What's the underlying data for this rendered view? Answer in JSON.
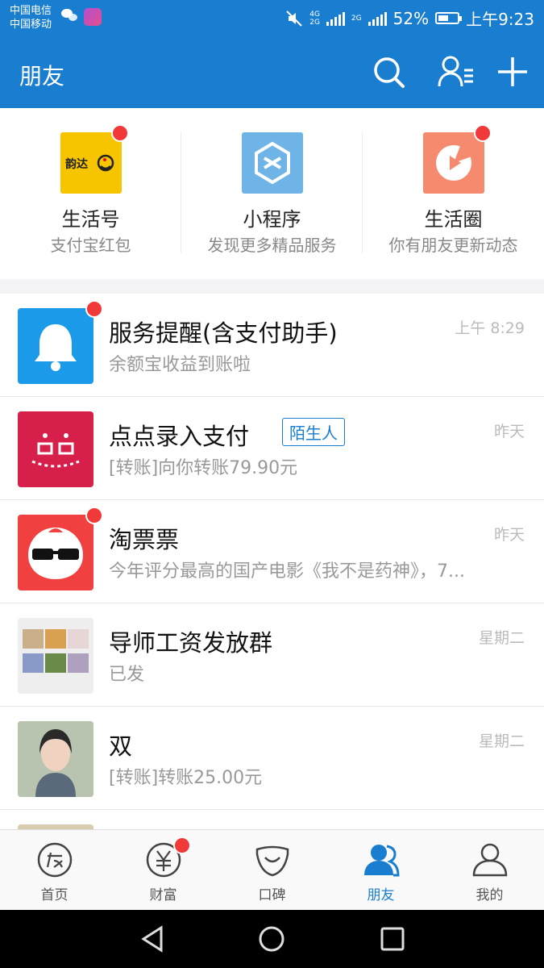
{
  "status_bar": {
    "carrier_1": "中国电信",
    "carrier_2": "中国移动",
    "net_1": "4G",
    "net_2": "2G",
    "net_3": "2G",
    "battery_text": "52%",
    "battery_level_percent": 52,
    "time": "上午9:23"
  },
  "header": {
    "title": "朋友",
    "icons": [
      "search-icon",
      "contacts-icon",
      "add-icon"
    ]
  },
  "quick_apps": [
    {
      "title": "生活号",
      "subtitle": "支付宝红包",
      "icon": "yunda-icon",
      "logo_text": "韵达",
      "badge": true
    },
    {
      "title": "小程序",
      "subtitle": "发现更多精品服务",
      "icon": "mini-program-icon",
      "badge": false
    },
    {
      "title": "生活圈",
      "subtitle": "你有朋友更新动态",
      "icon": "life-circle-icon",
      "badge": true
    }
  ],
  "messages": [
    {
      "title": "服务提醒(含支付助手)",
      "subtitle": "余额宝收益到账啦",
      "time": "上午 8:29",
      "badge": true,
      "tag": "",
      "avatar": "bell-icon"
    },
    {
      "title": "点点录入支付",
      "subtitle": "[转账]向你转账79.90元",
      "time": "昨天",
      "badge": false,
      "tag": "陌生人",
      "avatar": "diandian-icon"
    },
    {
      "title": "淘票票",
      "subtitle": "今年评分最高的国产电影《我不是药神》，7...",
      "time": "昨天",
      "badge": true,
      "tag": "",
      "avatar": "taopiaopiao-icon"
    },
    {
      "title": "导师工资发放群",
      "subtitle": "已发",
      "time": "星期二",
      "badge": false,
      "tag": "",
      "avatar": "group-avatar"
    },
    {
      "title": "双",
      "subtitle": "[转账]转账25.00元",
      "time": "星期二",
      "badge": false,
      "tag": "",
      "avatar": "user-avatar"
    }
  ],
  "tabbar": [
    {
      "label": "首页",
      "icon": "home-icon",
      "active": false,
      "badge": false
    },
    {
      "label": "财富",
      "icon": "wealth-icon",
      "active": false,
      "badge": true
    },
    {
      "label": "口碑",
      "icon": "koubei-icon",
      "active": false,
      "badge": false
    },
    {
      "label": "朋友",
      "icon": "friends-icon",
      "active": true,
      "badge": false
    },
    {
      "label": "我的",
      "icon": "me-icon",
      "active": false,
      "badge": false
    }
  ],
  "colors": {
    "brand": "#1a7ed0",
    "badge": "#f2393a",
    "yunda": "#f7c400",
    "mini_program": "#6fb4e6",
    "life_circle": "#f58a6e",
    "bell_bg": "#1a9ae8",
    "diandian_bg": "#d6204b",
    "taopiaopiao_bg": "#f04040"
  }
}
